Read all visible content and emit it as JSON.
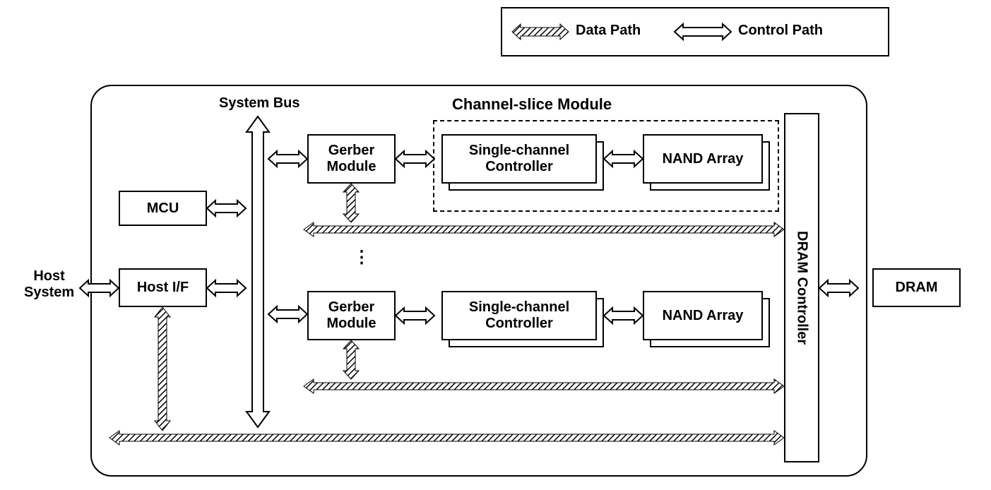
{
  "legend": {
    "data_path": "Data Path",
    "control_path": "Control Path"
  },
  "labels": {
    "system_bus": "System Bus",
    "channel_slice": "Channel-slice Module",
    "host_system": "Host\nSystem",
    "ellipsis": "⋮"
  },
  "blocks": {
    "mcu": "MCU",
    "host_if": "Host I/F",
    "gerber1": "Gerber\nModule",
    "gerber2": "Gerber\nModule",
    "scc1": "Single-channel\nController",
    "scc2": "Single-channel\nController",
    "nand1": "NAND Array",
    "nand2": "NAND Array",
    "dram_ctrl": "DRAM Controller",
    "dram": "DRAM"
  }
}
